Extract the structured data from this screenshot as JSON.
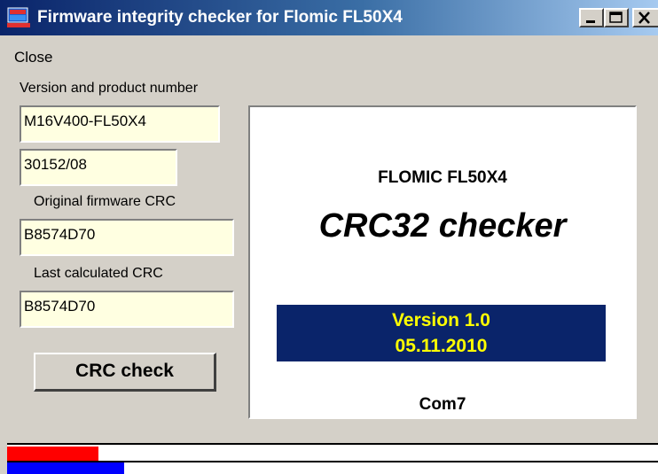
{
  "window": {
    "title": "Firmware integrity checker for Flomic FL50X4"
  },
  "menu": {
    "close_label": "Close"
  },
  "left_panel": {
    "version_label": "Version and product number",
    "product_value": "M16V400-FL50X4",
    "serial_value": "30152/08",
    "original_crc_label": "Original firmware CRC",
    "original_crc_value": "B8574D70",
    "last_crc_label": "Last calculated CRC",
    "last_crc_value": "B8574D70",
    "crc_check_button": "CRC check"
  },
  "info_panel": {
    "product_title": "FLOMIC FL50X4",
    "crc_title": "CRC32 checker",
    "version_line": "Version 1.0",
    "date_line": "05.11.2010",
    "port": "Com7"
  },
  "progress": {
    "red_fraction": 0.14,
    "blue_fraction": 0.18
  },
  "colors": {
    "titlebar_start": "#0a246a",
    "field_background": "#ffffe1",
    "version_box_background": "#0a246a",
    "version_box_text": "#ffff00",
    "progress_red": "#ff0000",
    "progress_blue": "#0000ff"
  },
  "icons": {
    "app": "app-window-icon",
    "minimize": "minimize-icon",
    "maximize": "maximize-icon",
    "close": "close-icon"
  }
}
